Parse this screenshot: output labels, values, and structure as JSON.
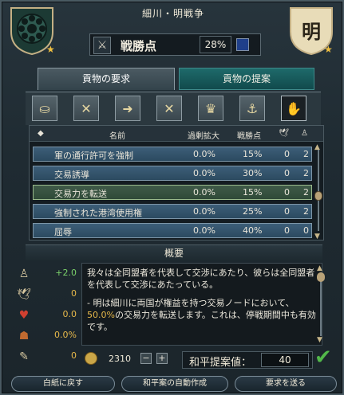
{
  "header": {
    "title": "細川・明戦争",
    "left_shield_icon": "hosokawa-crest-icon",
    "right_shield_text": "明",
    "warscore_label": "戦勝点",
    "warscore_value": "28%"
  },
  "tabs": {
    "demands": "貢物の要求",
    "offer": "貢物の提案"
  },
  "request_icons": [
    "gold-tribute-icon",
    "military-access-icon",
    "trade-steering-icon",
    "transfer-trade-icon",
    "crown-icon",
    "fleet-basing-icon",
    "humiliate-icon"
  ],
  "table": {
    "headers": {
      "name": "名前",
      "ae": "過剰拡大",
      "warscore": "戦勝点"
    },
    "rows": [
      {
        "name": "軍の通行許可を強制",
        "ae": "0.0%",
        "ws": "15%",
        "a": "0",
        "b": "2"
      },
      {
        "name": "交易誘導",
        "ae": "0.0%",
        "ws": "30%",
        "a": "0",
        "b": "2"
      },
      {
        "name": "交易力を転送",
        "ae": "0.0%",
        "ws": "15%",
        "a": "0",
        "b": "2"
      },
      {
        "name": "強制された港湾使用権",
        "ae": "0.0%",
        "ws": "25%",
        "a": "0",
        "b": "2"
      },
      {
        "name": "屈辱",
        "ae": "0.0%",
        "ws": "40%",
        "a": "0",
        "b": "0"
      }
    ]
  },
  "overview": {
    "title": "概要",
    "stats": [
      {
        "icon": "prestige-icon",
        "value": "+2.0"
      },
      {
        "icon": "dove-icon",
        "value": "0"
      },
      {
        "icon": "hearts-icon",
        "value": "0.0"
      },
      {
        "icon": "ae-icon",
        "value": "0.0%"
      },
      {
        "icon": "treaty-icon",
        "value": "0"
      }
    ],
    "text_p1": "我々は全同盟者を代表して交渉にあたり、彼らは全同盟者を代表して交渉にあたっている。",
    "text_p2_a": "- 明は細川に両国が権益を持つ交易ノードにおいて、",
    "text_p2_gold": "50.0%",
    "text_p2_b": "の交易力を転送します。これは、停戦期間中も有効です。"
  },
  "gold": {
    "value": "2310",
    "minus": "−",
    "plus": "+"
  },
  "peace": {
    "label": "和平提案値：",
    "value": "40"
  },
  "buttons": {
    "clear": "白紙に戻す",
    "auto": "和平案の自動作成",
    "send": "要求を送る"
  },
  "colors": {
    "accent_gold": "#e6b84a",
    "check_green": "#52b84a"
  }
}
